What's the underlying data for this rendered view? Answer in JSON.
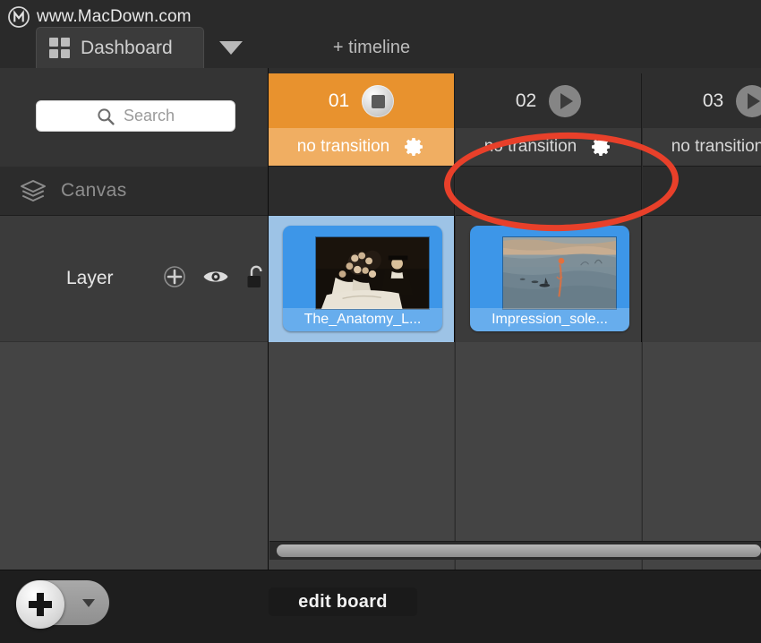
{
  "window": {
    "brand_text": "www.MacDown.com",
    "brand_logo_icon": "macdown-circle-m-logo"
  },
  "tabs": {
    "dashboard": {
      "label": "Dashboard",
      "icon": "grid-icon",
      "active": true
    },
    "dropdown_icon": "chevron-down-icon",
    "add_timeline_label": "+ timeline"
  },
  "search": {
    "placeholder": "Search",
    "value": "",
    "icon": "search-icon"
  },
  "rows": {
    "canvas": {
      "label": "Canvas",
      "icon": "layers-stack-icon"
    },
    "layer": {
      "label": "Layer",
      "tools": [
        {
          "name": "add-layer-icon",
          "title": "add"
        },
        {
          "name": "visibility-eye-icon",
          "title": "visible"
        },
        {
          "name": "unlock-padlock-icon",
          "title": "unlocked"
        }
      ]
    }
  },
  "columns": [
    {
      "number": "01",
      "transport": "stop",
      "transition_label": "no transition",
      "gear_icon": "gear-icon",
      "active": true,
      "cell": {
        "selected": true,
        "caption": "The_Anatomy_L...",
        "artwork": "the-anatomy-lesson"
      }
    },
    {
      "number": "02",
      "transport": "play",
      "transition_label": "no transition",
      "gear_icon": "gear-icon",
      "active": false,
      "cell": {
        "selected": false,
        "caption": "Impression_sole...",
        "artwork": "impression-sunrise"
      }
    },
    {
      "number": "03",
      "transport": "play",
      "transition_label": "no transition",
      "gear_icon": "gear-icon",
      "active": false,
      "cell": {
        "selected": false,
        "caption": "",
        "artwork": ""
      }
    }
  ],
  "scrollbar": {
    "orientation": "horizontal",
    "position_percent": 0
  },
  "bottom_bar": {
    "add_button": {
      "icon": "plus-icon",
      "dropdown_icon": "caret-down-icon"
    },
    "edit_board_label": "edit board"
  },
  "annotation": {
    "shape": "ellipse",
    "color": "#e8402a",
    "targets": "column-02-transition-bar"
  },
  "colors": {
    "active_column": "#e8922e",
    "active_column_strip": "#f0ae62",
    "tile_blue": "#3d96e8",
    "selected_cell_blue": "#9dc3e6",
    "annotation_red": "#e8402a",
    "window_bg": "#2e2e2e"
  }
}
